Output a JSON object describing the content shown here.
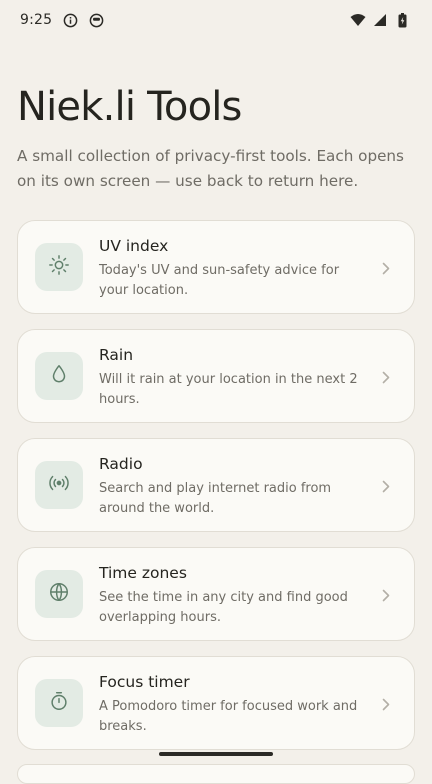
{
  "status_bar": {
    "time": "9:25",
    "icons": [
      "info-icon",
      "privacy-icon",
      "wifi-icon",
      "signal-icon",
      "battery-icon"
    ]
  },
  "header": {
    "title": "Niek.li Tools",
    "intro": "A small collection of privacy-first tools. Each opens on its own screen — use back to return here."
  },
  "tools": [
    {
      "icon": "sun-icon",
      "title": "UV index",
      "description": "Today's UV and sun-safety advice for your location."
    },
    {
      "icon": "raindrop-icon",
      "title": "Rain",
      "description": "Will it rain at your location in the next 2 hours."
    },
    {
      "icon": "radio-icon",
      "title": "Radio",
      "description": "Search and play internet radio from around the world."
    },
    {
      "icon": "globe-icon",
      "title": "Time zones",
      "description": "See the time in any city and find good overlapping hours."
    },
    {
      "icon": "stopwatch-icon",
      "title": "Focus timer",
      "description": "A Pomodoro timer for focused work and breaks."
    }
  ],
  "colors": {
    "background": "#f3f0ea",
    "card": "#fbfaf6",
    "icon_tile": "#e3ebe4",
    "icon_stroke": "#5f7f6a",
    "title_text": "#25241f",
    "secondary_text": "#6f6c65"
  }
}
